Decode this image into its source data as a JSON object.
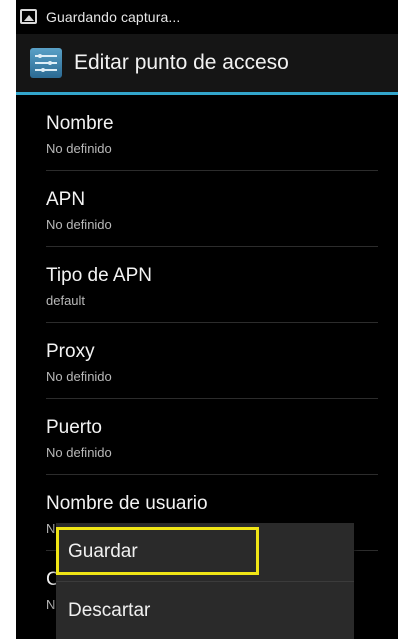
{
  "status_bar": {
    "notification": "Guardando captura..."
  },
  "action_bar": {
    "title": "Editar punto de acceso"
  },
  "preferences": [
    {
      "title": "Nombre",
      "summary": "No definido"
    },
    {
      "title": "APN",
      "summary": "No definido"
    },
    {
      "title": "Tipo de APN",
      "summary": "default"
    },
    {
      "title": "Proxy",
      "summary": "No definido"
    },
    {
      "title": "Puerto",
      "summary": "No definido"
    },
    {
      "title": "Nombre de usuario",
      "summary": "N"
    },
    {
      "title": "C",
      "summary": "N"
    }
  ],
  "menu": {
    "items": [
      {
        "label": "Guardar",
        "highlighted": true
      },
      {
        "label": "Descartar"
      }
    ]
  },
  "colors": {
    "accent": "#33a6cc",
    "highlight": "#f0e516",
    "background": "#000000"
  }
}
